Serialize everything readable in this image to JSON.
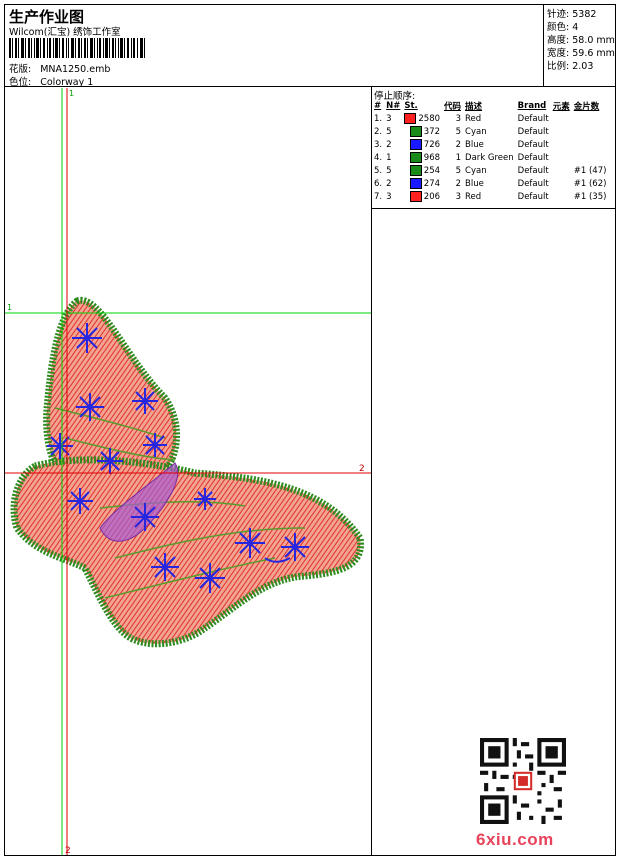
{
  "header": {
    "title": "生产作业图",
    "company": "Wilcom(汇宝) 绣饰工作室",
    "design_label": "花版:",
    "design_value": "MNA1250.emb",
    "colorway_label": "色位:",
    "colorway_value": "Colorway 1"
  },
  "specs": [
    {
      "label": "针迹:",
      "value": "5382"
    },
    {
      "label": "颜色:",
      "value": "4"
    },
    {
      "label": "高度:",
      "value": "58.0 mm"
    },
    {
      "label": "宽度:",
      "value": "59.6 mm"
    },
    {
      "label": "比例:",
      "value": "2.03"
    }
  ],
  "stop_sequence": {
    "title": "停止顺序:",
    "columns": [
      "#",
      "N#",
      "St.",
      "代码",
      "描述",
      "Brand",
      "元素",
      "金片数"
    ],
    "rows": [
      {
        "num": "1.",
        "n": "3",
        "color": "#ff2020",
        "st": "2580",
        "code": "3",
        "desc": "Red",
        "brand": "Default",
        "element": "",
        "sequins": ""
      },
      {
        "num": "2.",
        "n": "5",
        "color": "#1a8a1a",
        "st": "372",
        "code": "5",
        "desc": "Cyan",
        "brand": "Default",
        "element": "",
        "sequins": ""
      },
      {
        "num": "3.",
        "n": "2",
        "color": "#1a1aff",
        "st": "726",
        "code": "2",
        "desc": "Blue",
        "brand": "Default",
        "element": "",
        "sequins": ""
      },
      {
        "num": "4.",
        "n": "1",
        "color": "#1a8a1a",
        "st": "968",
        "code": "1",
        "desc": "Dark Green",
        "brand": "Default",
        "element": "",
        "sequins": ""
      },
      {
        "num": "5.",
        "n": "5",
        "color": "#1a8a1a",
        "st": "254",
        "code": "5",
        "desc": "Cyan",
        "brand": "Default",
        "element": "",
        "sequins": "#1 (47)"
      },
      {
        "num": "6.",
        "n": "2",
        "color": "#1a1aff",
        "st": "274",
        "code": "2",
        "desc": "Blue",
        "brand": "Default",
        "element": "",
        "sequins": "#1 (62)"
      },
      {
        "num": "7.",
        "n": "3",
        "color": "#ff2020",
        "st": "206",
        "code": "3",
        "desc": "Red",
        "brand": "Default",
        "element": "",
        "sequins": "#1 (35)"
      }
    ]
  },
  "guides": {
    "green_top_label": "1",
    "green_left_label": "1",
    "red_right_label": "2",
    "red_bottom_label": "2"
  },
  "watermark": {
    "site": "6xiu.com"
  },
  "colors": {
    "outline_green": "#2e8b1e",
    "fill_red": "#e0312a",
    "fill_pink": "#f09a8c",
    "motif_blue": "#2626e0",
    "guide_green": "#00d000",
    "guide_red": "#e00000"
  }
}
